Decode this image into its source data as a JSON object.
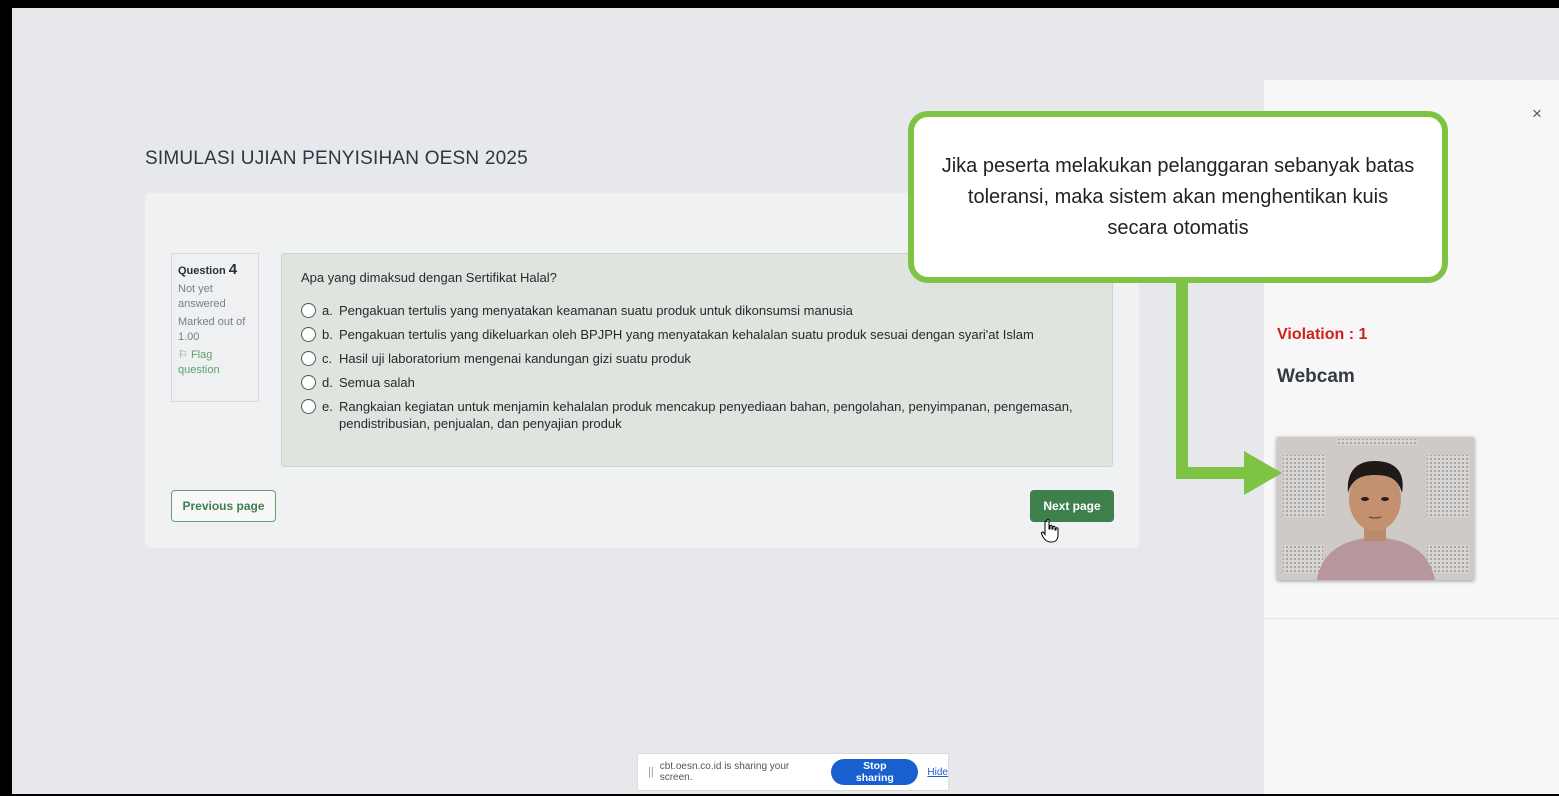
{
  "quiz": {
    "title": "SIMULASI UJIAN PENYISIHAN OESN 2025",
    "question_label": "Question",
    "question_number": "4",
    "status": "Not yet answered",
    "marked_out_of": "Marked out of 1.00",
    "flag_label": "Flag question",
    "question_text": "Apa yang dimaksud dengan Sertifikat Halal?",
    "options": [
      {
        "letter": "a.",
        "text": "Pengakuan tertulis yang menyatakan keamanan suatu produk untuk dikonsumsi manusia"
      },
      {
        "letter": "b.",
        "text": "Pengakuan tertulis yang dikeluarkan oleh BPJPH yang menyatakan kehalalan suatu produk sesuai dengan syari'at Islam"
      },
      {
        "letter": "c.",
        "text": "Hasil uji laboratorium mengenai kandungan gizi suatu produk"
      },
      {
        "letter": "d.",
        "text": "Semua salah"
      },
      {
        "letter": "e.",
        "text": "Rangkaian kegiatan untuk menjamin kehalalan produk mencakup penyediaan bahan, pengolahan, penyimpanan, pengemasan, pendistribusian, penjualan, dan penyajian produk"
      }
    ],
    "prev_label": "Previous page",
    "next_label": "Next page"
  },
  "proctor": {
    "close_symbol": "×",
    "violation_text": "Violation : 1",
    "webcam_title": "Webcam"
  },
  "callout": {
    "text": "Jika peserta melakukan pelanggaran sebanyak batas toleransi, maka sistem akan menghentikan kuis secara otomatis"
  },
  "share_bar": {
    "message": "cbt.oesn.co.id is sharing your screen.",
    "stop_label": "Stop sharing",
    "hide_label": "Hide"
  },
  "colors": {
    "accent_green": "#3d7f4d",
    "violation_red": "#d0201d",
    "callout_border": "#7ec343",
    "share_blue": "#1a5fd0"
  }
}
